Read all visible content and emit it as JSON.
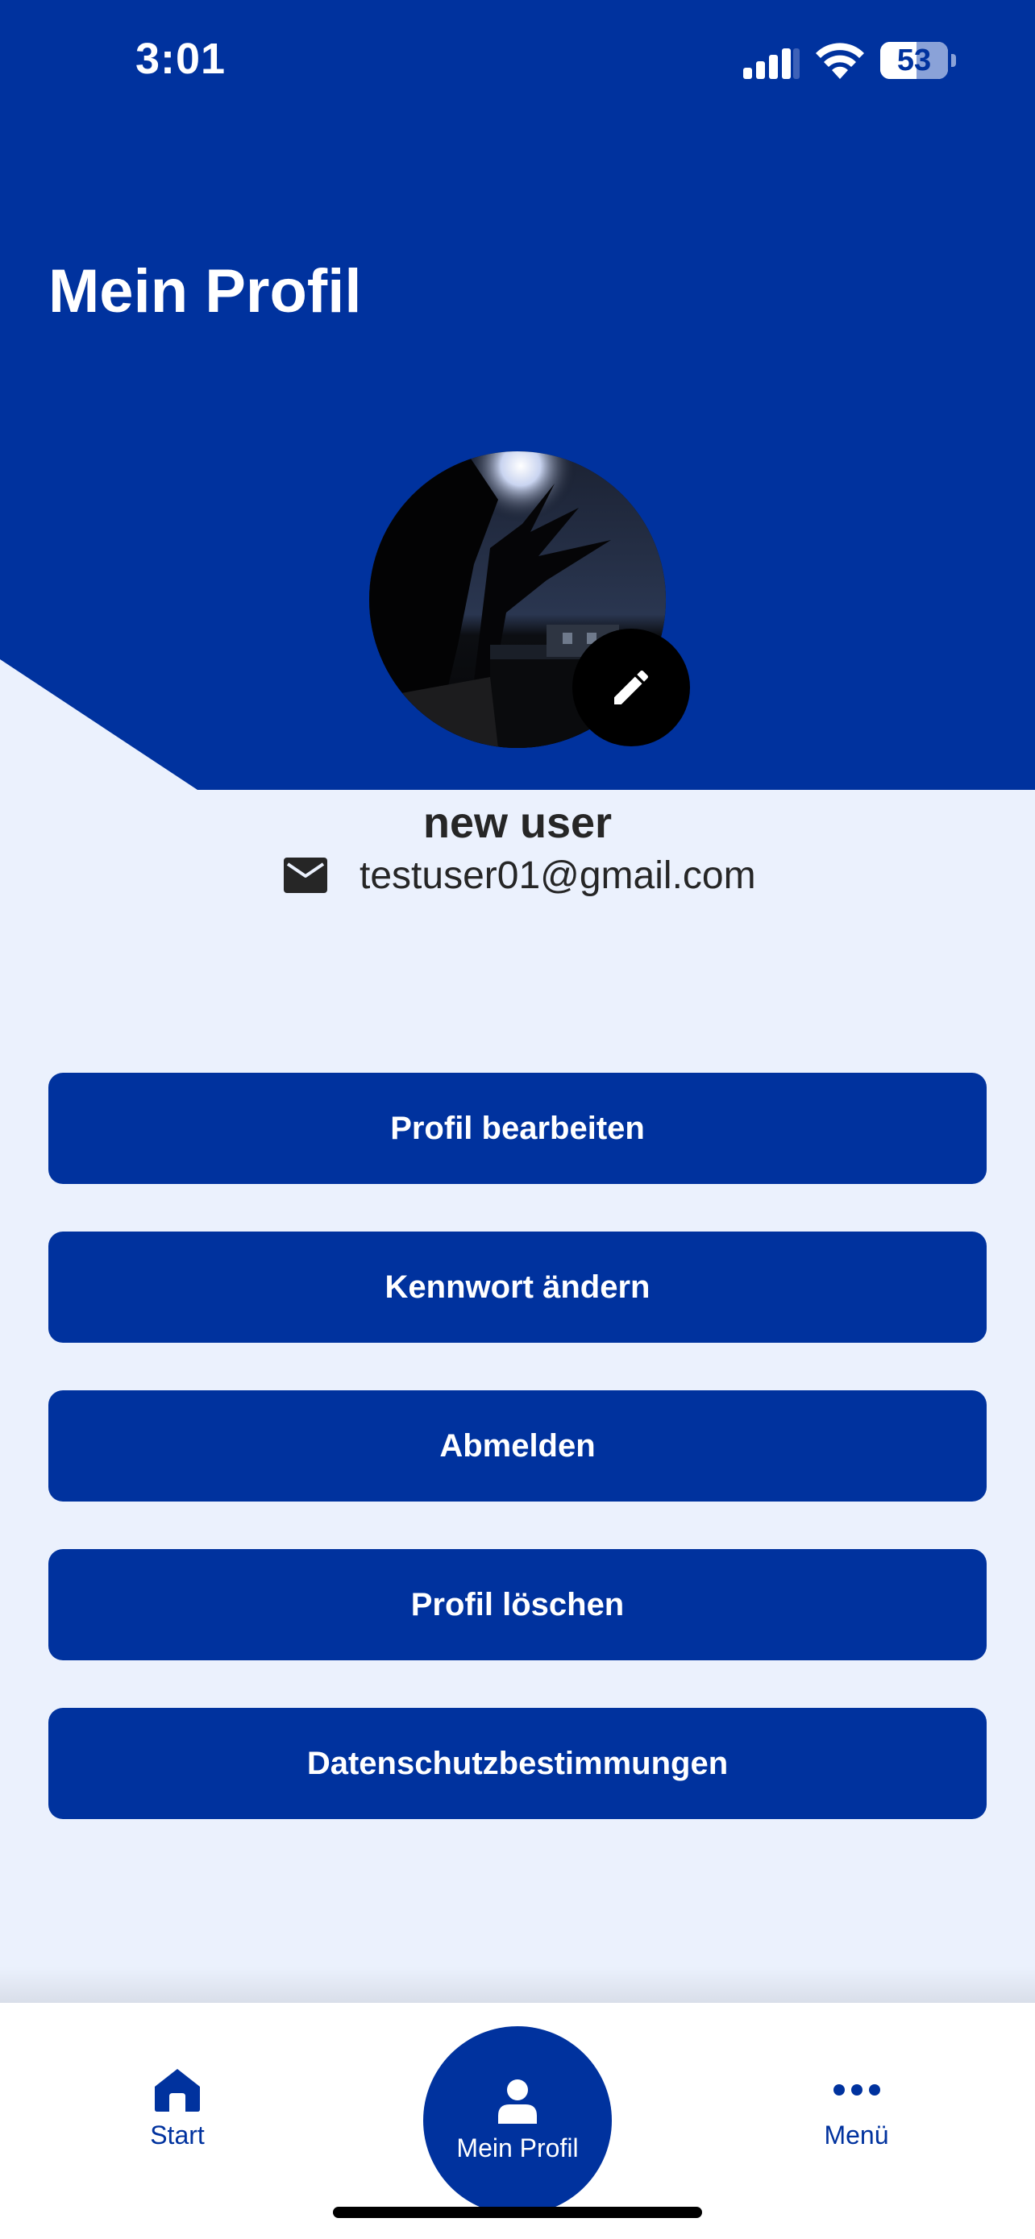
{
  "status_bar": {
    "time": "3:01",
    "battery": "53",
    "battery_level": 0.53
  },
  "header": {
    "title": "Mein Profil"
  },
  "profile": {
    "name": "new user",
    "email": "testuser01@gmail.com"
  },
  "actions": {
    "edit_profile": "Profil bearbeiten",
    "change_password": "Kennwort ändern",
    "logout": "Abmelden",
    "delete_profile": "Profil löschen",
    "privacy": "Datenschutzbestimmungen"
  },
  "tabbar": {
    "start": "Start",
    "profile": "Mein Profil",
    "menu": "Menü"
  },
  "colors": {
    "primary": "#00329E",
    "background": "#EBF1FD",
    "text": "#262626"
  },
  "icons": {
    "status": [
      "signal-icon",
      "wifi-icon",
      "battery-icon"
    ],
    "avatar_edit": "pencil-icon",
    "email": "envelope-icon",
    "tabs": [
      "home-icon",
      "person-icon",
      "more-dots-icon"
    ]
  }
}
